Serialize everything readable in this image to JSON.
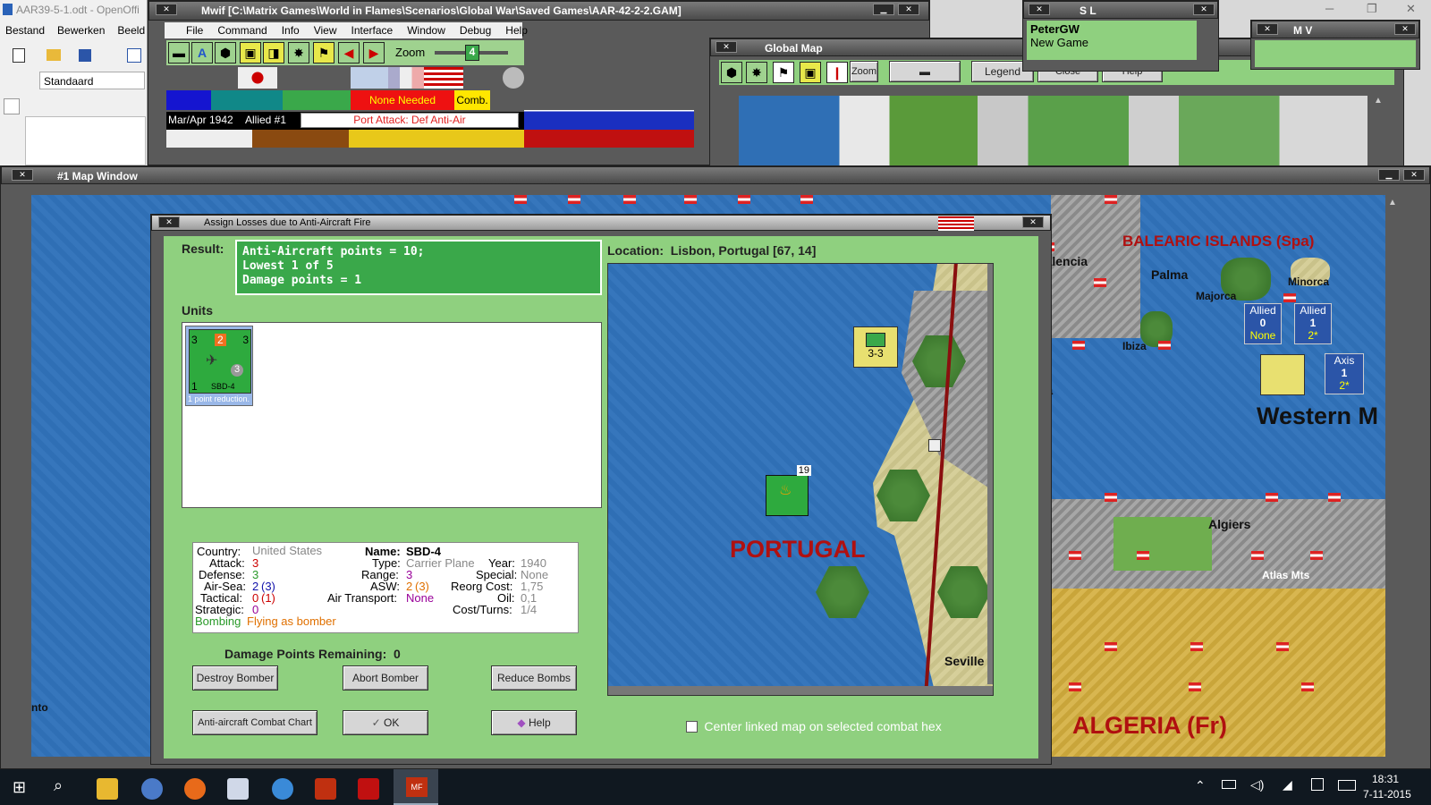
{
  "writer": {
    "title": "AAR39-5-1.odt - OpenOffi",
    "menu": [
      "Bestand",
      "Bewerken",
      "Beeld"
    ],
    "style_value": "Standaard"
  },
  "mwif": {
    "title": "Mwif [C:\\Matrix Games\\World in Flames\\Scenarios\\Global War\\Saved Games\\AAR-42-2-2.GAM]",
    "menu": [
      "File",
      "Command",
      "Info",
      "View",
      "Interface",
      "Window",
      "Debug",
      "Help"
    ],
    "zoom_label": "Zoom",
    "zoom_value": "4",
    "none_needed": "None Needed",
    "comb": "Comb.",
    "date": "Mar/Apr 1942",
    "allied_turn": "Allied #1",
    "phase": "Port Attack: Def Anti-Air"
  },
  "global_map": {
    "title": "Global Map",
    "zoom_label": "Zoom",
    "legend_label": "Legend",
    "close_label": "Close",
    "help_label": "Help"
  },
  "sl_window": {
    "title": "S L",
    "line1": "PeterGW",
    "line2": "New Game"
  },
  "mv_window": {
    "title": "M V"
  },
  "map_window": {
    "title": "#1 Map Window",
    "labels": {
      "valencia": "Valencia",
      "balearic": "BALEARIC ISLANDS (Spa)",
      "palma": "Palma",
      "majorca": "Majorca",
      "minorca": "Minorca",
      "ibiza": "Ibiza",
      "ena": "ena",
      "western": "Western M",
      "algiers": "Algiers",
      "atlas": "Atlas Mts",
      "algeria": "ALGERIA (Fr)",
      "nto": "nto"
    },
    "boxes": [
      {
        "side": "Allied",
        "value": "0",
        "sub": "None"
      },
      {
        "side": "Allied",
        "value": "1",
        "sub": "2*"
      },
      {
        "side": "Axis",
        "value": "1",
        "sub": "2*"
      }
    ]
  },
  "dialog": {
    "title": "Assign Losses due to Anti-Aircraft Fire",
    "result_label": "Result:",
    "result_lines": [
      "Anti-Aircraft points = 10;",
      "Lowest 1 of 5",
      "Damage points = 1"
    ],
    "units_label": "Units",
    "unit": {
      "attack": "3",
      "top": "2",
      "range": "3",
      "defense": "3",
      "name": "SBD-4",
      "bottom": "1",
      "note": "1 point reduction."
    },
    "location": "Location:  Lisbon, Portugal [67, 14]",
    "portugal": "PORTUGAL",
    "seville": "Seville",
    "corps_value": "3-3",
    "stack_count": "19",
    "info": {
      "country_label": "Country:",
      "country": "United States",
      "attack_label": "Attack:",
      "attack": "3",
      "defense_label": "Defense:",
      "defense": "3",
      "airsea_label": "Air-Sea:",
      "airsea": "2",
      "airsea_paren": "(3)",
      "tactical_label": "Tactical:",
      "tactical": "0",
      "tactical_paren": "(1)",
      "strategic_label": "Strategic:",
      "strategic": "0",
      "bombing_label": "Bombing",
      "bombing": "Flying as bomber",
      "name_label": "Name:",
      "name": "SBD-4",
      "type_label": "Type:",
      "type": "Carrier Plane",
      "range_label": "Range:",
      "range": "3",
      "asw_label": "ASW:",
      "asw": "2",
      "asw_paren": "(3)",
      "airtransport_label": "Air Transport:",
      "airtransport": "None",
      "year_label": "Year:",
      "year": "1940",
      "special_label": "Special:",
      "special": "None",
      "reorg_label": "Reorg Cost:",
      "reorg": "1,75",
      "oil_label": "Oil:",
      "oil": "0,1",
      "costturns_label": "Cost/Turns:",
      "costturns": "1/4"
    },
    "damage_remaining": "Damage Points Remaining:  0",
    "buttons": {
      "destroy": "Destroy Bomber",
      "abort": "Abort Bomber",
      "reduce": "Reduce Bombs",
      "chart": "Anti-aircraft Combat Chart",
      "ok": "OK",
      "help": "Help"
    },
    "center_checkbox": "Center linked map on selected combat hex"
  },
  "taskbar": {
    "time": "18:31",
    "date": "7-11-2015"
  },
  "colors": {
    "panel_green": "#8fd07f",
    "result_green": "#3aa84a",
    "accent_red": "#b01010"
  }
}
